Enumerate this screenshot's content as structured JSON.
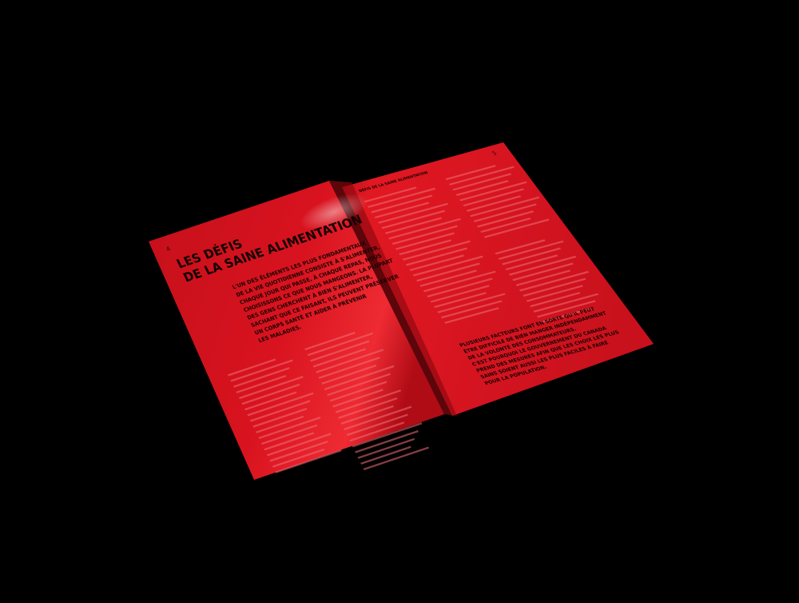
{
  "background_color": "#000000",
  "page_color": "#d81420",
  "left_page": {
    "page_number": "4",
    "title_line1": "LES DÉFIS",
    "title_line2": "DE LA SAINE ALIMENTATION",
    "intro_lines": [
      "L'UN DES ÉLÉMENTS LES PLUS FONDAMENTAUX",
      "DE LA VIE QUOTIDIENNE CONSISTE À S'ALIMENTER.",
      "CHAQUE JOUR QUI PASSE, À CHAQUE REPAS, NOUS",
      "CHOISISSONS CE QUE NOUS MANGEONS. LA PLUPART",
      "DES GENS CHERCHENT À BIEN S'ALIMENTER,",
      "SACHANT QUE CE FAISANT, ILS PEUVENT PRÉSERVER",
      "UN CORPS SANTÉ ET AIDER À PRÉVENIR",
      "LES MALADIES."
    ]
  },
  "right_page": {
    "page_number": "5",
    "running_header": "DÉFIS DE LA SAINE ALIMENTATION",
    "pull_quote_lines": [
      "PLUSIEURS FACTEURS FONT EN SORTE QU'IL PEUT",
      "ÊTRE DIFFICILE DE BIEN MANGER INDÉPENDAMMENT",
      "DE LA VOLONTÉ DES CONSOMMATEURS.",
      "C'EST POURQUOI LE GOUVERNEMENT DU CANADA",
      "PREND DES MESURES AFIN QUE LES CHOIX LES PLUS",
      "SAINS SOIENT AUSSI LES PLUS FACILES À FAIRE",
      "POUR LA POPULATION."
    ]
  }
}
